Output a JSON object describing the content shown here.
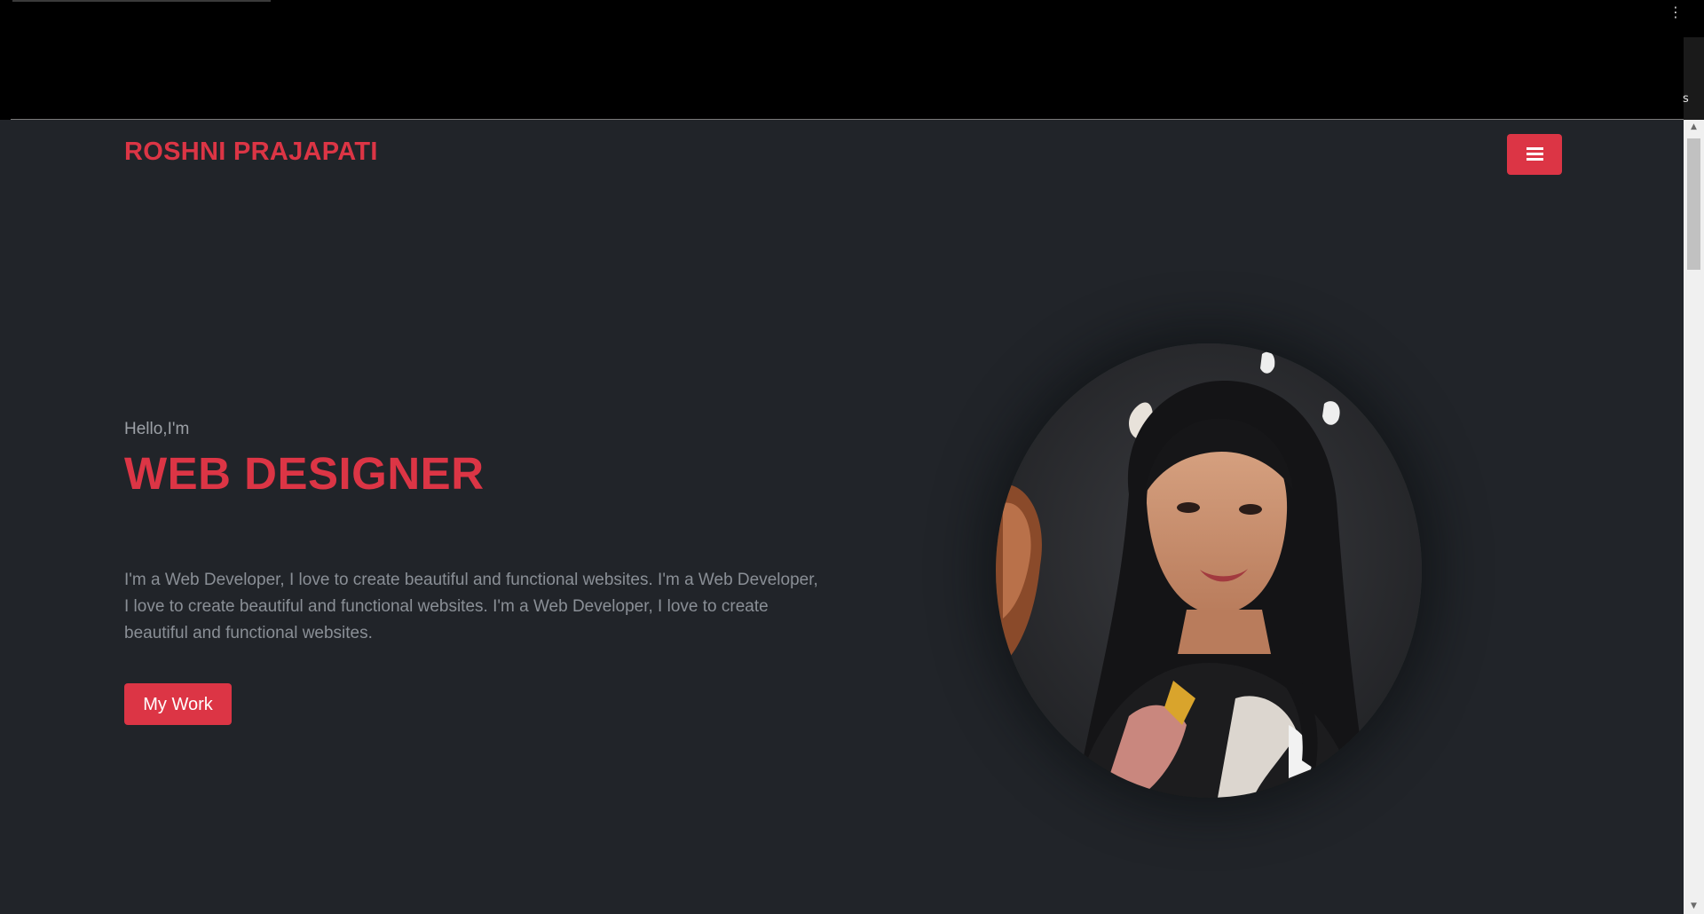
{
  "browser": {
    "menu_dots_icon": "vertical-dots-icon",
    "side_letter": "s"
  },
  "header": {
    "brand": "ROSHNI PRAJAPATI",
    "menu_icon": "hamburger-icon"
  },
  "hero": {
    "greeting": "Hello,I'm",
    "title": "WEB DESIGNER",
    "description": "I'm a Web Developer, I love to create beautiful and functional websites. I'm a Web Developer, I love to create beautiful and functional websites. I'm a Web Developer, I love to create beautiful and functional websites.",
    "cta_label": "My Work"
  },
  "colors": {
    "accent": "#dc3545",
    "background": "#212429",
    "muted_text": "#8a8f96"
  }
}
